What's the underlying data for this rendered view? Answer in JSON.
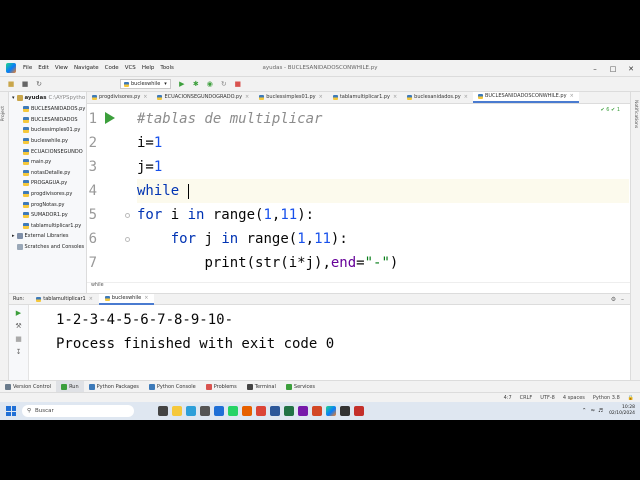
{
  "window": {
    "title": "ayudas - BUCLESANIDADOSCONWHILE.py",
    "menu": [
      "File",
      "Edit",
      "View",
      "Navigate",
      "Code",
      "VCS",
      "Help",
      "Tools"
    ]
  },
  "toolbar": {
    "run_config": "bucleswhile"
  },
  "left_stripe": {
    "project_label": "Project"
  },
  "right_stripe": {
    "label": "Notifications"
  },
  "project": {
    "root_name": "ayudas",
    "root_path": "C:\\AYPSpytho",
    "files": [
      {
        "name": "BUCLESANIDADOS.py",
        "selected": false
      },
      {
        "name": "BUCLESANIDADOS",
        "selected": false
      },
      {
        "name": "buclessimples01.py",
        "selected": false
      },
      {
        "name": "bucleswhile.py",
        "selected": false
      },
      {
        "name": "ECUACIONSEGUNDO",
        "selected": false
      },
      {
        "name": "main.py",
        "selected": false
      },
      {
        "name": "notasDetalle.py",
        "selected": false
      },
      {
        "name": "PROGAGUA.py",
        "selected": false
      },
      {
        "name": "progdivisores.py",
        "selected": false
      },
      {
        "name": "progNotas.py",
        "selected": false
      },
      {
        "name": "SUMADOR1.py",
        "selected": false
      },
      {
        "name": "tablamultiplicar1.py",
        "selected": false
      }
    ],
    "external_libraries": "External Libraries",
    "scratches": "Scratches and Consoles"
  },
  "editor": {
    "tabs": [
      {
        "label": "progdivisores.py",
        "active": false
      },
      {
        "label": "ECUACIONSEGUNDOGRADO.py",
        "active": false
      },
      {
        "label": "buclessimples01.py",
        "active": false
      },
      {
        "label": "tablamultiplicar1.py",
        "active": false
      },
      {
        "label": "buclesanidados.py",
        "active": false
      },
      {
        "label": "BUCLESANIDADOSCONWHILE.py",
        "active": true
      }
    ],
    "line_numbers": [
      "1",
      "2",
      "3",
      "4",
      "5",
      "6",
      "7"
    ],
    "code": {
      "l1_comment": "#tablas de multiplicar",
      "l2_var": "i=",
      "l2_num": "1",
      "l3_var": "j=",
      "l3_num": "1",
      "l4_kw": "while ",
      "l5_for": "for",
      "l5_mid": " i ",
      "l5_in": "in",
      "l5_range": " range(",
      "l5_n1": "1",
      "l5_comma": ",",
      "l5_n2": "11",
      "l5_end": "):",
      "l6_indent": "    ",
      "l6_for": "for",
      "l6_mid": " j ",
      "l6_in": "in",
      "l6_range": " range(",
      "l6_n1": "1",
      "l6_comma": ",",
      "l6_n2": "11",
      "l6_end": "):",
      "l7_indent": "        ",
      "l7_call": "print(str(i*j),",
      "l7_param": "end",
      "l7_eq": "=",
      "l7_str": "\"-\"",
      "l7_end": ")"
    },
    "status": "✔ 6  ✔ 1",
    "breadcrumb": "while"
  },
  "run_panel": {
    "label": "Run:",
    "tabs": [
      {
        "label": "tablamultiplicar1",
        "active": false
      },
      {
        "label": "bucleswhile",
        "active": true
      }
    ],
    "output": [
      "1-2-3-4-5-6-7-8-9-10-",
      "Process finished with exit code 0"
    ]
  },
  "tool_windows": [
    {
      "label": "Version Control",
      "active": false,
      "color": "#6a7b8c"
    },
    {
      "label": "Run",
      "active": true,
      "color": "#3c9f3c"
    },
    {
      "label": "Python Packages",
      "active": false,
      "color": "#3d7ab9"
    },
    {
      "label": "Python Console",
      "active": false,
      "color": "#3d7ab9"
    },
    {
      "label": "Problems",
      "active": false,
      "color": "#d9534f"
    },
    {
      "label": "Terminal",
      "active": false,
      "color": "#444444"
    },
    {
      "label": "Services",
      "active": false,
      "color": "#3c9f3c"
    }
  ],
  "statusbar": {
    "position": "4:7",
    "line_sep": "CRLF",
    "encoding": "UTF-8",
    "indent": "4 spaces",
    "interpreter": "Python 3.8"
  },
  "taskbar": {
    "search_placeholder": "Buscar",
    "time": "10:28",
    "date": "02/10/2024"
  },
  "colors": {
    "accent": "#4a7bd0",
    "keyword": "#0033b3",
    "number": "#1750eb",
    "string": "#067d17"
  }
}
